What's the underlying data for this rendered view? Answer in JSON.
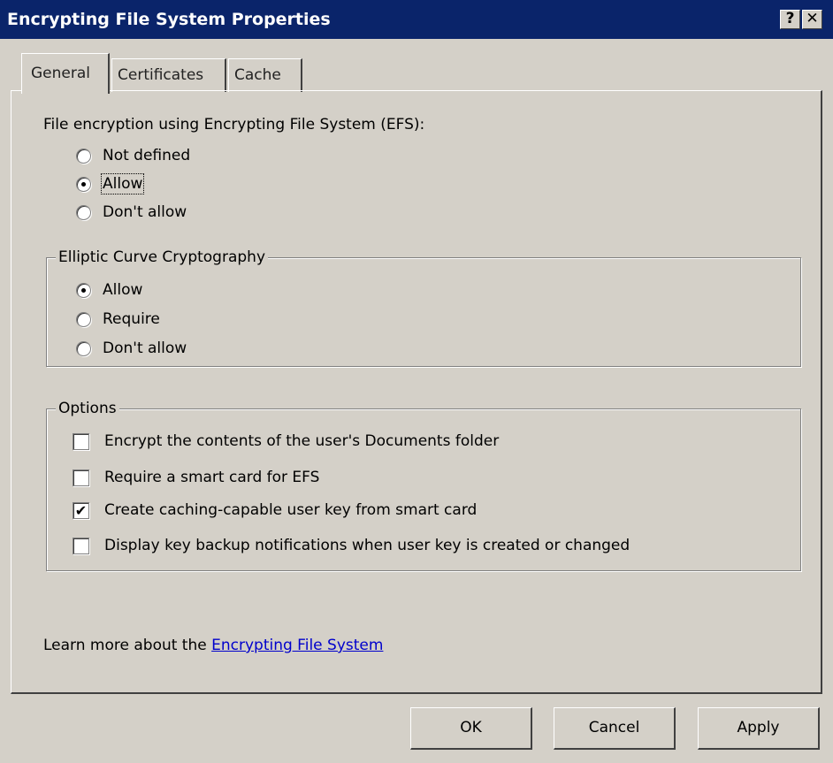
{
  "window": {
    "title": "Encrypting File System Properties",
    "help_glyph": "?",
    "close_glyph": "✕"
  },
  "tabs": [
    {
      "label": "General",
      "active": true
    },
    {
      "label": "Certificates",
      "active": false
    },
    {
      "label": "Cache",
      "active": false
    }
  ],
  "efs": {
    "heading": "File encryption using Encrypting File System (EFS):",
    "options": [
      {
        "label": "Not defined",
        "checked": false
      },
      {
        "label": "Allow",
        "checked": true
      },
      {
        "label": "Don't allow",
        "checked": false
      }
    ]
  },
  "ecc": {
    "title": "Elliptic Curve Cryptography",
    "options": [
      {
        "label": "Allow",
        "checked": true
      },
      {
        "label": "Require",
        "checked": false
      },
      {
        "label": "Don't allow",
        "checked": false
      }
    ]
  },
  "options_group": {
    "title": "Options",
    "items": [
      {
        "label": "Encrypt the contents of the user's Documents folder",
        "checked": false
      },
      {
        "label": "Require a smart card for EFS",
        "checked": false
      },
      {
        "label": "Create caching-capable user key from smart card",
        "checked": true
      },
      {
        "label": "Display key backup notifications when user key is created or changed",
        "checked": false
      }
    ]
  },
  "learn_more": {
    "prefix": "Learn more about the ",
    "link": "Encrypting File System"
  },
  "buttons": {
    "ok": "OK",
    "cancel": "Cancel",
    "apply": "Apply"
  }
}
